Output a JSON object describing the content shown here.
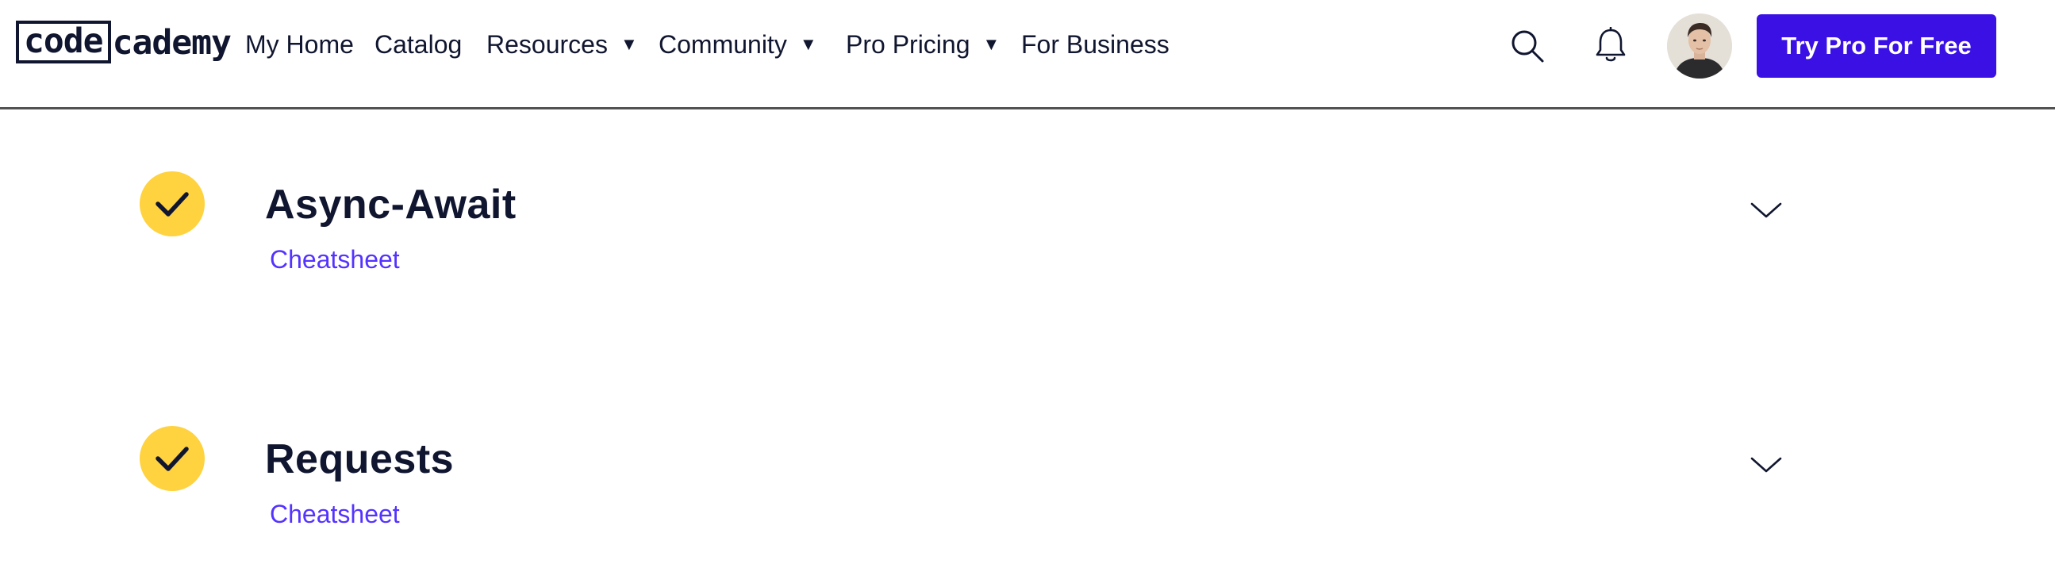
{
  "header": {
    "logo": {
      "boxed": "code",
      "rest": "cademy"
    },
    "nav": [
      {
        "label": "My Home",
        "caret": false
      },
      {
        "label": "Catalog",
        "caret": false
      },
      {
        "label": "Resources",
        "caret": true
      },
      {
        "label": "Community",
        "caret": true
      },
      {
        "label": "Pro Pricing",
        "caret": true
      },
      {
        "label": "For Business",
        "caret": false
      }
    ],
    "caret_glyph": "▼",
    "icons": {
      "search": "search-icon",
      "notifications": "bell-icon",
      "avatar": "user-avatar"
    },
    "cta_label": "Try Pro For Free"
  },
  "modules": [
    {
      "title": "Async-Await",
      "link_label": "Cheatsheet",
      "completed": true
    },
    {
      "title": "Requests",
      "link_label": "Cheatsheet",
      "completed": true
    }
  ],
  "colors": {
    "brand_navy": "#10162f",
    "cta_blue": "#3a10e5",
    "link_purple": "#5533ff",
    "check_yellow": "#ffd23f"
  }
}
